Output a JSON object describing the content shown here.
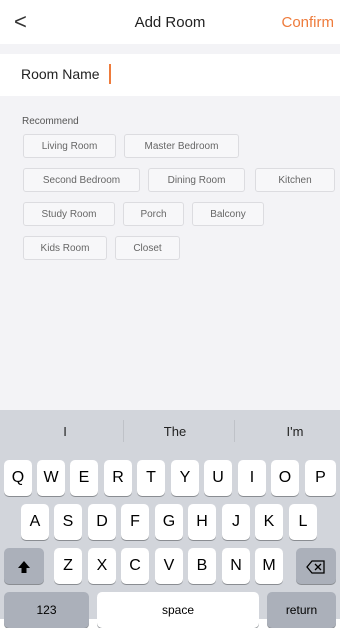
{
  "nav": {
    "back_glyph": "<",
    "title": "Add Room",
    "confirm": "Confirm"
  },
  "name_row": {
    "label": "Room Name"
  },
  "recommend": {
    "title": "Recommend",
    "chips": [
      "Living Room",
      "Master Bedroom",
      "Second Bedroom",
      "Dining Room",
      "Kitchen",
      "Study Room",
      "Porch",
      "Balcony",
      "Kids Room",
      "Closet"
    ]
  },
  "keyboard": {
    "suggestions": [
      "I",
      "The",
      "I'm"
    ],
    "row1": [
      "Q",
      "W",
      "E",
      "R",
      "T",
      "Y",
      "U",
      "I",
      "O",
      "P"
    ],
    "row2": [
      "A",
      "S",
      "D",
      "F",
      "G",
      "H",
      "J",
      "K",
      "L"
    ],
    "row3": [
      "Z",
      "X",
      "C",
      "V",
      "B",
      "N",
      "M"
    ],
    "shift_icon": "shift-icon",
    "delete_icon": "delete-icon",
    "numbers": "123",
    "space": "space",
    "return": "return"
  },
  "colors": {
    "accent": "#ee7b3b",
    "background": "#f3f3f6",
    "keyboard": "#d2d5db"
  }
}
